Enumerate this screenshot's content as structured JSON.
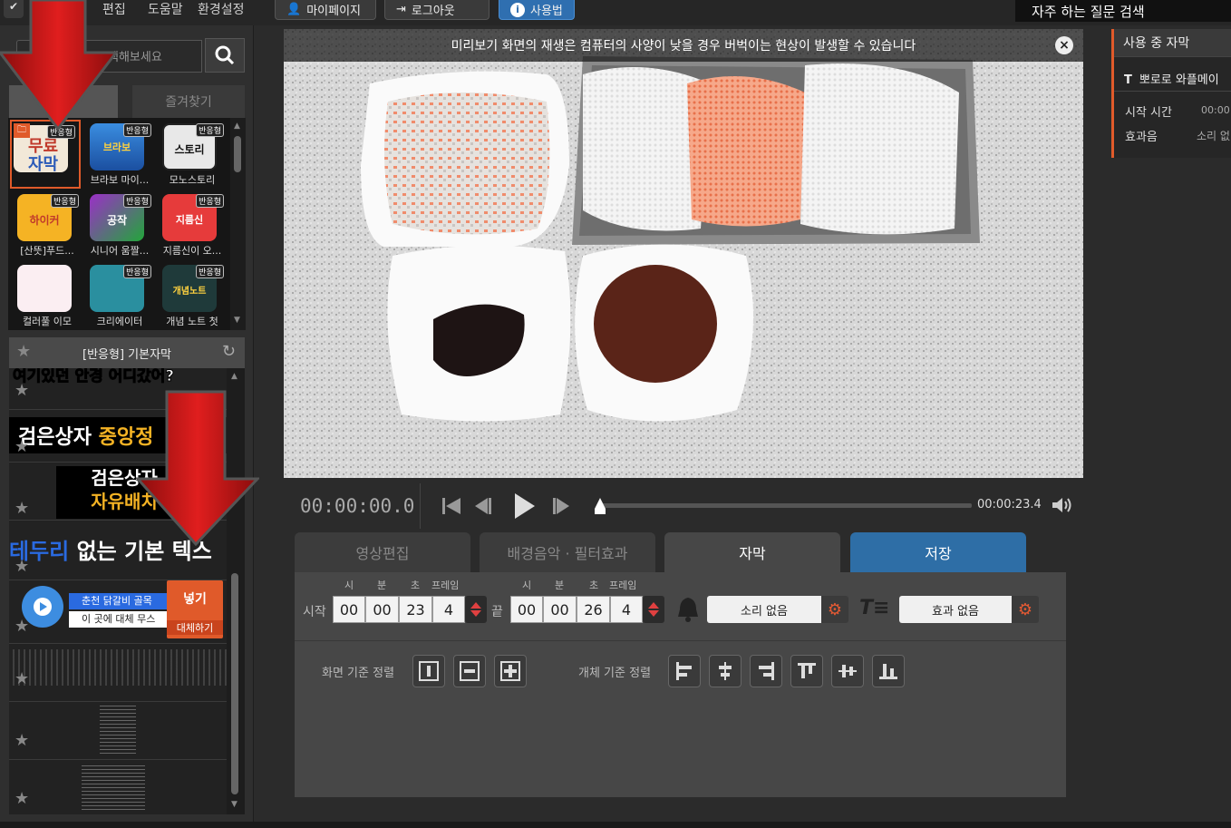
{
  "menu": {
    "edit": "편집",
    "help": "도움말",
    "settings": "환경설정"
  },
  "top_buttons": {
    "mypage": "마이페이지",
    "logout": "로그아웃",
    "usage": "사용법"
  },
  "faq": "자주 하는 질문 검색",
  "search": {
    "placeholder": "색해보세요"
  },
  "left_tabs": {
    "tab1": "기",
    "favorites": "즐겨찾기"
  },
  "templates": [
    {
      "label": "",
      "badge": "반응형",
      "thumb_text": "무료\n자막"
    },
    {
      "label": "브라보 마이...",
      "badge": "반응형",
      "thumb_text": "브라보"
    },
    {
      "label": "모노스토리",
      "badge": "반응형",
      "thumb_text": "스토리"
    },
    {
      "label": "[산뜻]푸드...",
      "badge": "반응형",
      "thumb_text": "하이커"
    },
    {
      "label": "시니어 움짤...",
      "badge": "반응형",
      "thumb_text": "공작"
    },
    {
      "label": "지름신이 오...",
      "badge": "반응형",
      "thumb_text": "지름신"
    },
    {
      "label": "컬러풀 이모",
      "badge": "",
      "thumb_text": ""
    },
    {
      "label": "크리에이터",
      "badge": "반응형",
      "thumb_text": ""
    },
    {
      "label": "개념 노트 첫",
      "badge": "반응형",
      "thumb_text": "개념노트"
    }
  ],
  "subtitle_header": "[반응형] 기본자막",
  "subtitle_items": {
    "row1": "여기있던 안경 어디갔어?",
    "row2a": "검은상자 ",
    "row2b": "중앙정",
    "row3a": "검은상자",
    "row3b": "자유배치",
    "row4a": "테두리",
    "row4b": " 없는 기본 텍스",
    "row5a": "춘천 닭갈비 골목",
    "row5b": "이 곳에 대체 무스",
    "replace_top": "넣기",
    "replace_bottom": "대체하기"
  },
  "notice": "미리보기 화면의 재생은 컴퓨터의 사양이 낮을 경우 버벅이는 현상이 발생할 수 있습니다",
  "player": {
    "current": "00:00:00.0",
    "duration": "00:00:23.4"
  },
  "main_tabs": {
    "video_edit": "영상편집",
    "bgm": "배경음악 · 필터효과",
    "subtitle": "자막",
    "save": "저장"
  },
  "time_labels": {
    "h": "시",
    "m": "분",
    "s": "초",
    "f": "프레임",
    "start": "시작",
    "end": "끝"
  },
  "start_time": {
    "h": "00",
    "m": "00",
    "s": "23",
    "f": "4"
  },
  "end_time": {
    "h": "00",
    "m": "00",
    "s": "26",
    "f": "4"
  },
  "sound": "소리 없음",
  "effect": "효과 없음",
  "align": {
    "screen": "화면 기준 정렬",
    "object": "개체 기준 정렬"
  },
  "right_panel": {
    "title": "사용 중 자막",
    "item": "뽀로로 와플메이",
    "start_label": "시작 시간",
    "start_value": "00:00",
    "sfx_label": "효과음",
    "sfx_value": "소리 없"
  },
  "colors": {
    "accent": "#e05a2a",
    "save_tab": "#2e6ea6",
    "active_tab": "#474747"
  }
}
